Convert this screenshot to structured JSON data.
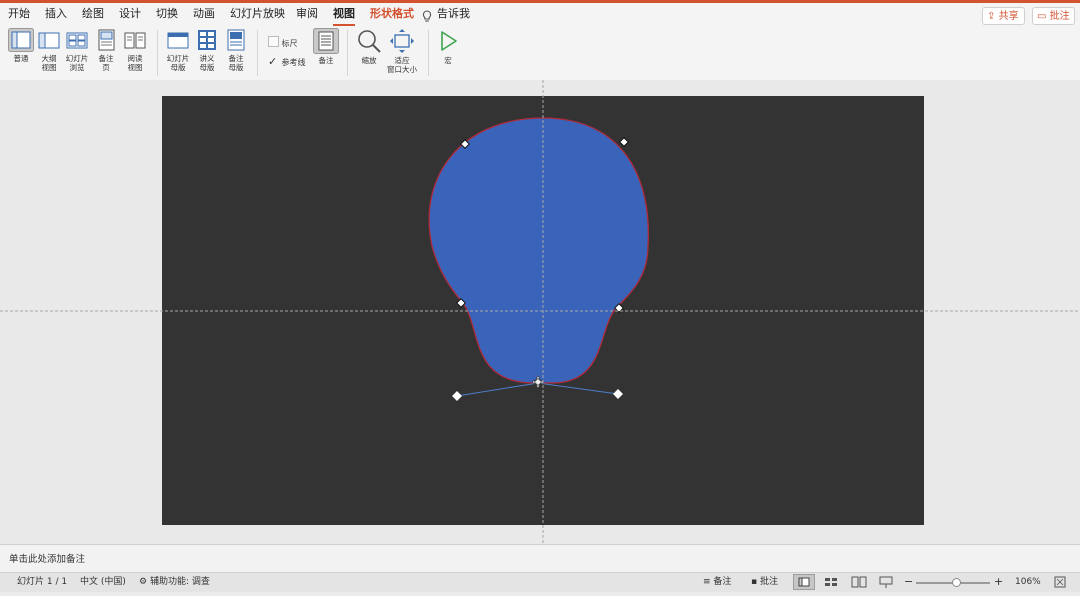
{
  "tabs": [
    "开始",
    "插入",
    "绘图",
    "设计",
    "切换",
    "动画",
    "幻灯片放映",
    "审阅",
    "视图",
    "形状格式",
    "告诉我"
  ],
  "active_tab": "视图",
  "share_label": "共享",
  "comments_label": "批注",
  "toolbar": {
    "normal": "普通",
    "outline": "大纲\n视图",
    "sorter": "幻灯片\n浏览",
    "notes_page": "备注\n页",
    "reading": "阅读\n视图",
    "slide_master": "幻灯片\n母版",
    "handout_master": "讲义\n母版",
    "notes_master": "备注\n母版",
    "ruler": "标尺",
    "guides": "参考线",
    "notes": "备注",
    "zoom": "缩放",
    "fit": "适应\n窗口大小",
    "macro": "宏"
  },
  "checkboxes": {
    "ruler": false,
    "guides": true
  },
  "notes_placeholder": "单击此处添加备注",
  "status": {
    "slide_info": "幻灯片 1 / 1",
    "language": "中文 (中国)",
    "accessibility": "辅助功能: 调查",
    "notes_btn": "备注",
    "comments_btn": "批注",
    "zoom_level": "106%",
    "zoom_fraction": 0.55
  },
  "colors": {
    "accent": "#d35230",
    "shape_fill": "#3a64b9",
    "shape_outline": "#b02a3a",
    "slide_bg": "#333333"
  }
}
